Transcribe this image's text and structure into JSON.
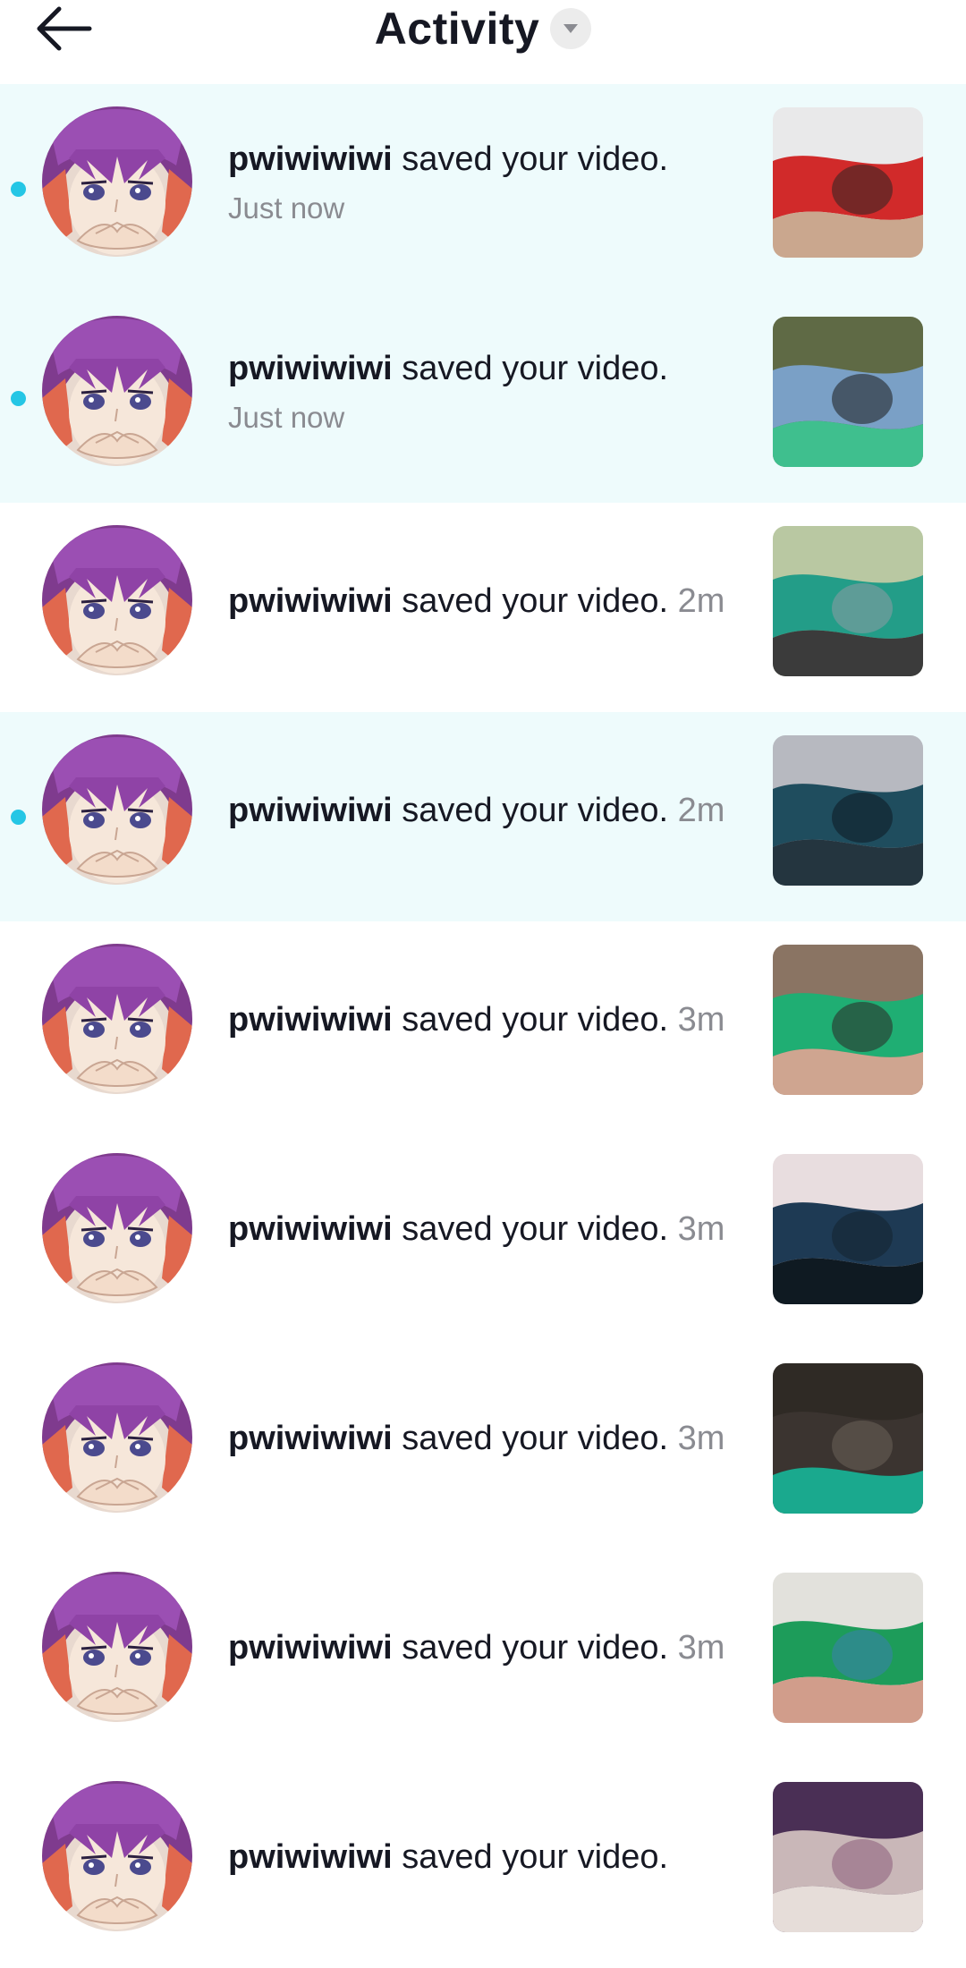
{
  "header": {
    "title": "Activity"
  },
  "rows": [
    {
      "user": "pwiwiwiwi",
      "action": " saved your video.",
      "time": "Just now",
      "unread": true,
      "layout": "two-line",
      "thumb": {
        "top": "#e9e9ea",
        "mid": "#d12a2a",
        "bottom": "#caa78e",
        "accent": "#2a2523"
      }
    },
    {
      "user": "pwiwiwiwi",
      "action": " saved your video.",
      "time": "Just now",
      "unread": true,
      "layout": "two-line",
      "thumb": {
        "top": "#5f6a45",
        "mid": "#7aa0c6",
        "bottom": "#3fbf8e",
        "accent": "#1c1c1c"
      }
    },
    {
      "user": "pwiwiwiwi",
      "action": " saved your video.",
      "time": "2m",
      "unread": false,
      "layout": "one-line",
      "thumb": {
        "top": "#b9c8a2",
        "mid": "#239d88",
        "bottom": "#3b3b3b",
        "accent": "#8f9aa4"
      }
    },
    {
      "user": "pwiwiwiwi",
      "action": " saved your video.",
      "time": "2m",
      "unread": true,
      "layout": "one-line",
      "thumb": {
        "top": "#b7b9c0",
        "mid": "#1f4d5e",
        "bottom": "#24353f",
        "accent": "#0c1a22"
      }
    },
    {
      "user": "pwiwiwiwi",
      "action": " saved your video.",
      "time": "3m",
      "unread": false,
      "layout": "one-line",
      "thumb": {
        "top": "#8a7463",
        "mid": "#1fae73",
        "bottom": "#cfa590",
        "accent": "#2b2624"
      }
    },
    {
      "user": "pwiwiwiwi",
      "action": " saved your video.",
      "time": "3m",
      "unread": false,
      "layout": "one-line",
      "thumb": {
        "top": "#e8dddf",
        "mid": "#1e3a54",
        "bottom": "#0f1a22",
        "accent": "#14222e"
      }
    },
    {
      "user": "pwiwiwiwi",
      "action": " saved your video.",
      "time": "3m",
      "unread": false,
      "layout": "one-line",
      "thumb": {
        "top": "#2f2a25",
        "mid": "#3b3430",
        "bottom": "#1aa98e",
        "accent": "#6b6259"
      }
    },
    {
      "user": "pwiwiwiwi",
      "action": " saved your video.",
      "time": "3m",
      "unread": false,
      "layout": "one-line",
      "thumb": {
        "top": "#e2e1dc",
        "mid": "#1d9c5a",
        "bottom": "#d19d8b",
        "accent": "#3b7fb0"
      }
    },
    {
      "user": "pwiwiwiwi",
      "action": " saved your video.",
      "time": "",
      "unread": false,
      "layout": "one-line",
      "thumb": {
        "top": "#4a2f55",
        "mid": "#c9b7b8",
        "bottom": "#e6ddd9",
        "accent": "#8a5c7a"
      }
    }
  ],
  "colors": {
    "unread_bg": "#eefbfc",
    "unread_dot": "#25c6e5",
    "secondary_text": "#8a8b91",
    "primary_text": "#161823"
  },
  "icons": {
    "back": "arrow-left-icon",
    "title_dropdown": "caret-down-icon"
  }
}
